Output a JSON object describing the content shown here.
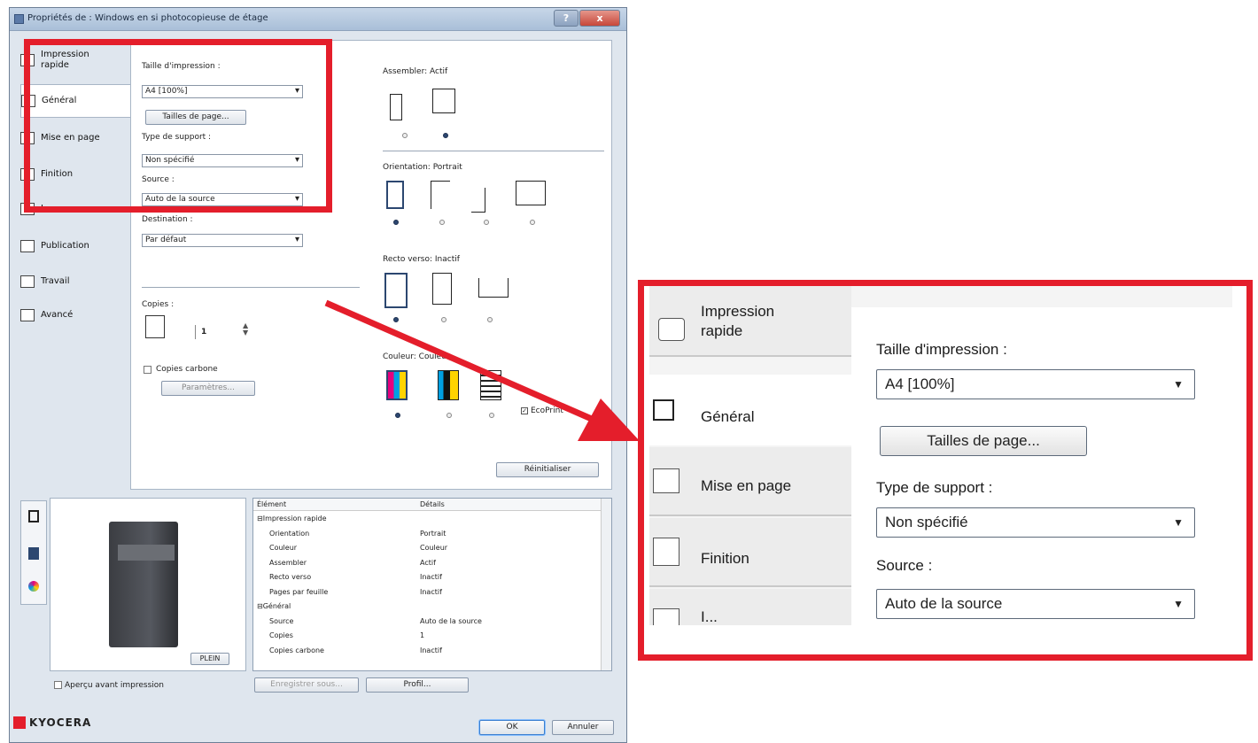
{
  "window": {
    "title": "Propriétés de : Windows en si photocopieuse de étage",
    "help_label": "?",
    "close_label": "x"
  },
  "nav": [
    {
      "label": "Impression\nrapide"
    },
    {
      "label": "Général"
    },
    {
      "label": "Mise en page"
    },
    {
      "label": "Finition"
    },
    {
      "label": "I..."
    },
    {
      "label": "Publication"
    },
    {
      "label": "Travail"
    },
    {
      "label": "Avancé"
    }
  ],
  "form": {
    "print_size_label": "Taille d'impression :",
    "print_size_value": "A4 [100%]",
    "page_sizes_button": "Tailles de page...",
    "media_type_label": "Type de support :",
    "media_type_value": "Non spécifié",
    "source_label": "Source :",
    "source_value": "Auto de la source",
    "destination_label": "Destination :",
    "destination_value": "Par défaut",
    "copies_label": "Copies :",
    "copies_value": "1",
    "carbon_copies_label": "Copies carbone",
    "parameters_button": "Paramètres...",
    "collate_label": "Assembler: Actif",
    "orientation_label": "Orientation: Portrait",
    "duplex_label": "Recto verso: Inactif",
    "color_label": "Couleur: Couleur",
    "ecoprint_label": "EcoPrint",
    "reset_button": "Réinitialiser"
  },
  "details": {
    "col_element": "Élément",
    "col_details": "Détails",
    "rows": [
      {
        "element": "⊟Impression rapide",
        "detail": "",
        "indent": 0
      },
      {
        "element": "Orientation",
        "detail": "Portrait",
        "indent": 1
      },
      {
        "element": "Couleur",
        "detail": "Couleur",
        "indent": 1
      },
      {
        "element": "Assembler",
        "detail": "Actif",
        "indent": 1
      },
      {
        "element": "Recto verso",
        "detail": "Inactif",
        "indent": 1
      },
      {
        "element": "Pages par feuille",
        "detail": "Inactif",
        "indent": 1
      },
      {
        "element": "⊟Général",
        "detail": "",
        "indent": 0
      },
      {
        "element": "Source",
        "detail": "Auto de la source",
        "indent": 1
      },
      {
        "element": "Copies",
        "detail": "1",
        "indent": 1
      },
      {
        "element": "Copies carbone",
        "detail": "Inactif",
        "indent": 1
      }
    ]
  },
  "footer": {
    "fullsize_button": "PLEIN",
    "confirm_label": "Aperçu avant impression",
    "save_as_button": "Enregistrer sous...",
    "profile_button": "Profil...",
    "ok_button": "OK",
    "cancel_button": "Annuler",
    "brand": "KYOCERA"
  },
  "zoom": {
    "nav": [
      {
        "label": "Impression\nrapide"
      },
      {
        "label": "Général"
      },
      {
        "label": "Mise en page"
      },
      {
        "label": "Finition"
      },
      {
        "label": "I..."
      }
    ],
    "print_size_label": "Taille d'impression :",
    "print_size_value": "A4  [100%]",
    "page_sizes_button": "Tailles de page...",
    "media_type_label": "Type de support :",
    "media_type_value": "Non spécifié",
    "source_label": "Source :",
    "source_value": "Auto de la source"
  },
  "colors": {
    "highlight": "#e41e2b",
    "accent": "#2c4770"
  }
}
